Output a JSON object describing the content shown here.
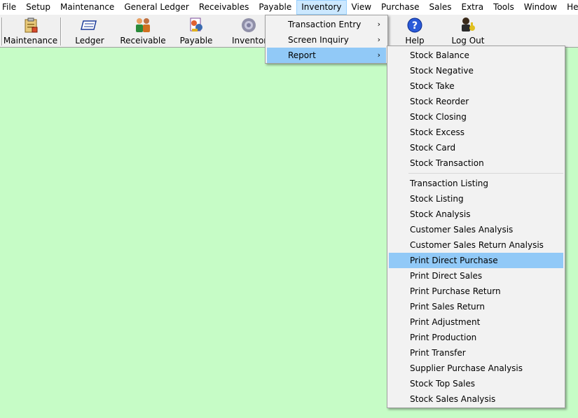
{
  "menubar": {
    "items": [
      "File",
      "Setup",
      "Maintenance",
      "General Ledger",
      "Receivables",
      "Payable",
      "Inventory",
      "View",
      "Purchase",
      "Sales",
      "Extra",
      "Tools",
      "Window",
      "Help"
    ]
  },
  "toolbar": {
    "maintenance": "Maintenance",
    "ledger": "Ledger",
    "receivable": "Receivable",
    "payable": "Payable",
    "inventory": "Inventory",
    "help": "Help",
    "logout": "Log Out"
  },
  "inventory_menu": {
    "items": [
      "Transaction Entry",
      "Screen Inquiry",
      "Report"
    ],
    "submenu_arrow": "›"
  },
  "report_menu": {
    "group1": [
      "Stock Balance",
      "Stock Negative",
      "Stock Take",
      "Stock Reorder",
      "Stock Closing",
      "Stock Excess",
      "Stock Card",
      "Stock Transaction"
    ],
    "group2": [
      "Transaction Listing",
      "Stock Listing",
      "Stock Analysis",
      "Customer Sales Analysis",
      "Customer Sales Return Analysis",
      "Print Direct Purchase",
      "Print Direct Sales",
      "Print Purchase Return",
      "Print Sales Return",
      "Print Adjustment",
      "Print Production",
      "Print Transfer",
      "Supplier Purchase Analysis",
      "Stock Top Sales",
      "Stock Sales Analysis"
    ],
    "highlighted": "Print Direct Purchase"
  },
  "colors": {
    "workspace": "#c6fcc6",
    "menu_highlight": "#91c9f7",
    "menubar_active": "#cce8ff"
  }
}
